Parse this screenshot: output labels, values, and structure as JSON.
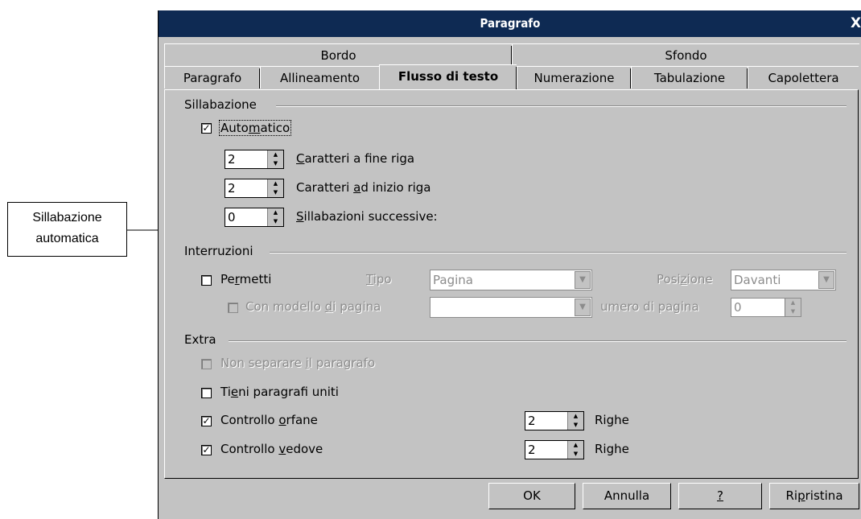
{
  "callout": {
    "line1": "Sillabazione",
    "line2": "automatica"
  },
  "dialog": {
    "title": "Paragrafo",
    "close": "X"
  },
  "tabs_row1": [
    "Bordo",
    "Sfondo"
  ],
  "tabs_row2": [
    "Paragrafo",
    "Allineamento",
    "Flusso di testo",
    "Numerazione",
    "Tabulazione",
    "Capolettera"
  ],
  "hyphen": {
    "title": "Sillabazione",
    "auto_checked": "✓",
    "auto_pre": "Auto",
    "auto_u": "m",
    "auto_post": "atico",
    "end_value": "2",
    "end_u": "C",
    "end_label": "aratteri a fine riga",
    "start_value": "2",
    "start_pre": "Caratteri ",
    "start_u": "a",
    "start_post": "d inizio riga",
    "max_value": "0",
    "max_u": "S",
    "max_label": "illabazioni successive:"
  },
  "breaks": {
    "title": "Interruzioni",
    "permit_pre": "Pe",
    "permit_u": "r",
    "permit_post": "metti",
    "type_u": "T",
    "type_label": "ipo",
    "type_value": "Pagina",
    "pos_pre": "Posi",
    "pos_u": "z",
    "pos_post": "ione",
    "pos_value": "Davanti",
    "template_pre": "Con modello ",
    "template_u": "d",
    "template_post": "i pagina",
    "pagenum_label": "umero di pagina",
    "pagenum_value": "0"
  },
  "extra": {
    "title": "Extra",
    "nosplit_pre": "Non separare ",
    "nosplit_u": "i",
    "nosplit_post": "l paragrafo",
    "keep_pre": "Ti",
    "keep_u": "e",
    "keep_post": "ni paragrafi uniti",
    "orphan_checked": "✓",
    "orphan_pre": "Controllo ",
    "orphan_u": "o",
    "orphan_post": "rfane",
    "orphan_value": "2",
    "orphan_unit": "Righe",
    "widow_checked": "✓",
    "widow_pre": "Controllo ",
    "widow_u": "v",
    "widow_post": "edove",
    "widow_value": "2",
    "widow_unit": "Righe"
  },
  "buttons": {
    "ok": "OK",
    "cancel": "Annulla",
    "help": "?",
    "reset_pre": "Ri",
    "reset_u": "p",
    "reset_post": "ristina"
  },
  "icons": {
    "spin_up": "▲",
    "spin_down": "▼",
    "dropdown": "▼"
  }
}
